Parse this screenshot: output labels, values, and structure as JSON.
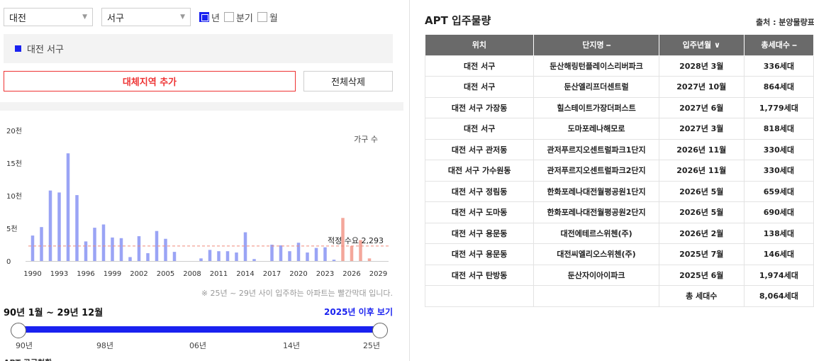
{
  "filters": {
    "city": "대전",
    "district": "서구",
    "periods": [
      {
        "label": "년",
        "checked": true
      },
      {
        "label": "분기",
        "checked": false
      },
      {
        "label": "월",
        "checked": false
      }
    ]
  },
  "selected_region": "대전 서구",
  "buttons": {
    "add_region": "대체지역 추가",
    "delete_all": "전체삭제"
  },
  "chart_data": {
    "type": "bar",
    "title": "",
    "legend_label": "가구 수",
    "xlabel": "",
    "ylabel": "",
    "y_ticks": [
      "0",
      "5천",
      "10천",
      "15천",
      "20천"
    ],
    "ylim": [
      0,
      20000
    ],
    "x_tick_labels": [
      "1990",
      "1993",
      "1996",
      "1999",
      "2002",
      "2005",
      "2008",
      "2011",
      "2014",
      "2017",
      "2020",
      "2023",
      "2026",
      "2029"
    ],
    "years": [
      1990,
      1991,
      1992,
      1993,
      1994,
      1995,
      1996,
      1997,
      1998,
      1999,
      2000,
      2001,
      2002,
      2003,
      2004,
      2005,
      2006,
      2007,
      2008,
      2009,
      2010,
      2011,
      2012,
      2013,
      2014,
      2015,
      2016,
      2017,
      2018,
      2019,
      2020,
      2021,
      2022,
      2023,
      2024,
      2025,
      2026,
      2027,
      2028,
      2029
    ],
    "values": [
      3900,
      5200,
      10800,
      10500,
      16500,
      10100,
      3000,
      5100,
      5600,
      3600,
      3500,
      600,
      3800,
      1200,
      4600,
      3400,
      1400,
      0,
      0,
      400,
      1700,
      1500,
      1500,
      1300,
      4400,
      300,
      0,
      2500,
      2400,
      1500,
      2800,
      1300,
      2000,
      2100,
      200,
      6600,
      2300,
      3200,
      400,
      0
    ],
    "highlight_years": [
      2025,
      2026,
      2027,
      2028,
      2029
    ],
    "colors": {
      "normal": "#9aa4f5",
      "highlight": "#f4a79b",
      "reference": "#f08a7a"
    },
    "reference_line": {
      "label": "적정 수요",
      "value": 2293,
      "value_label": "2,293"
    },
    "grid": false
  },
  "note": "※ 25년 ~ 29년 사이 입주하는 아파트는 빨간막대 입니다.",
  "range": {
    "text": "90년 1월 ~ 29년 12월",
    "link": "2025년 이후 보기",
    "ticks": [
      "90년",
      "98년",
      "06년",
      "14년",
      "25년"
    ]
  },
  "bottom_cut_text": "APT 공급현황",
  "apt": {
    "title": "APT 입주물량",
    "source": "출처 : 분양물량표",
    "headers": [
      "위치",
      "단지명 ⎯",
      "입주년월 ∨",
      "총세대수 ⎯"
    ],
    "rows": [
      [
        "대전 서구",
        "둔산해링턴플레이스리버파크",
        "2028년 3월",
        "336세대"
      ],
      [
        "대전 서구",
        "둔산엘리프더센트럴",
        "2027년 10월",
        "864세대"
      ],
      [
        "대전 서구 가장동",
        "힐스테이트가장더퍼스트",
        "2027년 6월",
        "1,779세대"
      ],
      [
        "대전 서구",
        "도마포레나해모로",
        "2027년 3월",
        "818세대"
      ],
      [
        "대전 서구 관저동",
        "관저푸르지오센트럴파크1단지",
        "2026년 11월",
        "330세대"
      ],
      [
        "대전 서구 가수원동",
        "관저푸르지오센트럴파크2단지",
        "2026년 11월",
        "330세대"
      ],
      [
        "대전 서구 정림동",
        "한화포레나대전월평공원1단지",
        "2026년 5월",
        "659세대"
      ],
      [
        "대전 서구 도마동",
        "한화포레나대전월평공원2단지",
        "2026년 5월",
        "690세대"
      ],
      [
        "대전 서구 용문동",
        "대전에테르스위첸(주)",
        "2026년 2월",
        "138세대"
      ],
      [
        "대전 서구 용문동",
        "대전씨엘리오스위첸(주)",
        "2025년 7월",
        "146세대"
      ],
      [
        "대전 서구 탄방동",
        "둔산자이아이파크",
        "2025년 6월",
        "1,974세대"
      ]
    ],
    "total_label": "총 세대수",
    "total_value": "8,064세대"
  }
}
